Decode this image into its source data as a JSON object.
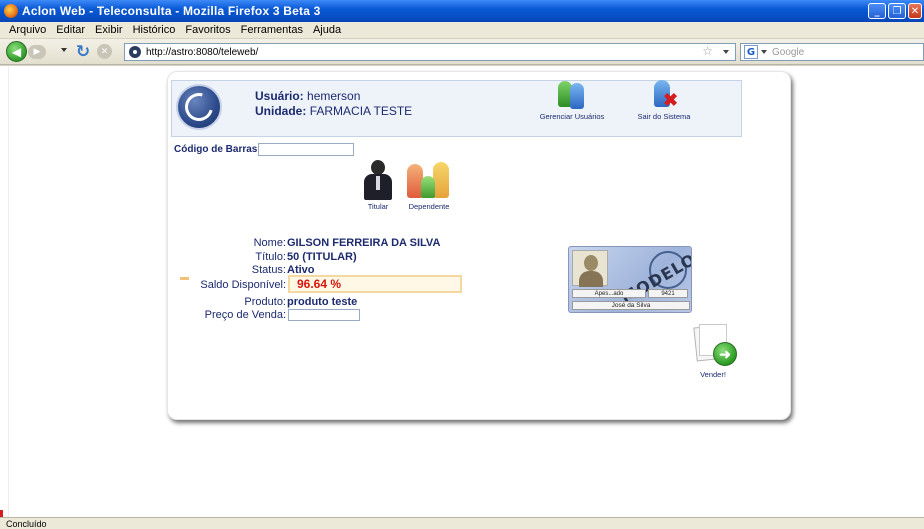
{
  "window": {
    "title": "Aclon Web - Teleconsulta - Mozilla Firefox 3 Beta 3",
    "controls": [
      "_",
      "❐",
      "✕"
    ]
  },
  "menu": [
    "Arquivo",
    "Editar",
    "Exibir",
    "Histórico",
    "Favoritos",
    "Ferramentas",
    "Ajuda"
  ],
  "nav": {
    "url": "http://astro:8080/teleweb/",
    "search_engine": "G",
    "search_placeholder": "Google",
    "star": "☆"
  },
  "header": {
    "user_label": "Usuário:",
    "user_value": "hemerson",
    "unit_label": "Unidade:",
    "unit_value": "FARMACIA TESTE",
    "manage_users": "Gerenciar Usuários",
    "logout": "Sair do Sistema"
  },
  "barcode": {
    "label": "Código de Barras:",
    "value": ""
  },
  "options": {
    "titular": "Titular",
    "dependente": "Dependente"
  },
  "fields": {
    "nome_label": "Nome:",
    "nome_value": "GILSON FERREIRA DA SILVA",
    "titulo_label": "Título:",
    "titulo_value": "50 (TITULAR)",
    "status_label": "Status:",
    "status_value": "Ativo",
    "saldo_label": "Saldo Disponível:",
    "saldo_value": "96.64 %",
    "produto_label": "Produto:",
    "produto_value": "produto teste",
    "preco_label": "Preço de Venda:",
    "preco_value": ""
  },
  "card": {
    "stamp": "MODELO",
    "field1": "Apes...ado",
    "number": "9421",
    "name": "José da Silva"
  },
  "vender_label": "Vender!",
  "status_text": "Concluído",
  "colors": {
    "accent": "#1c2a6e",
    "saldo": "#d8140c",
    "titlebar": "#0a5ad6"
  }
}
